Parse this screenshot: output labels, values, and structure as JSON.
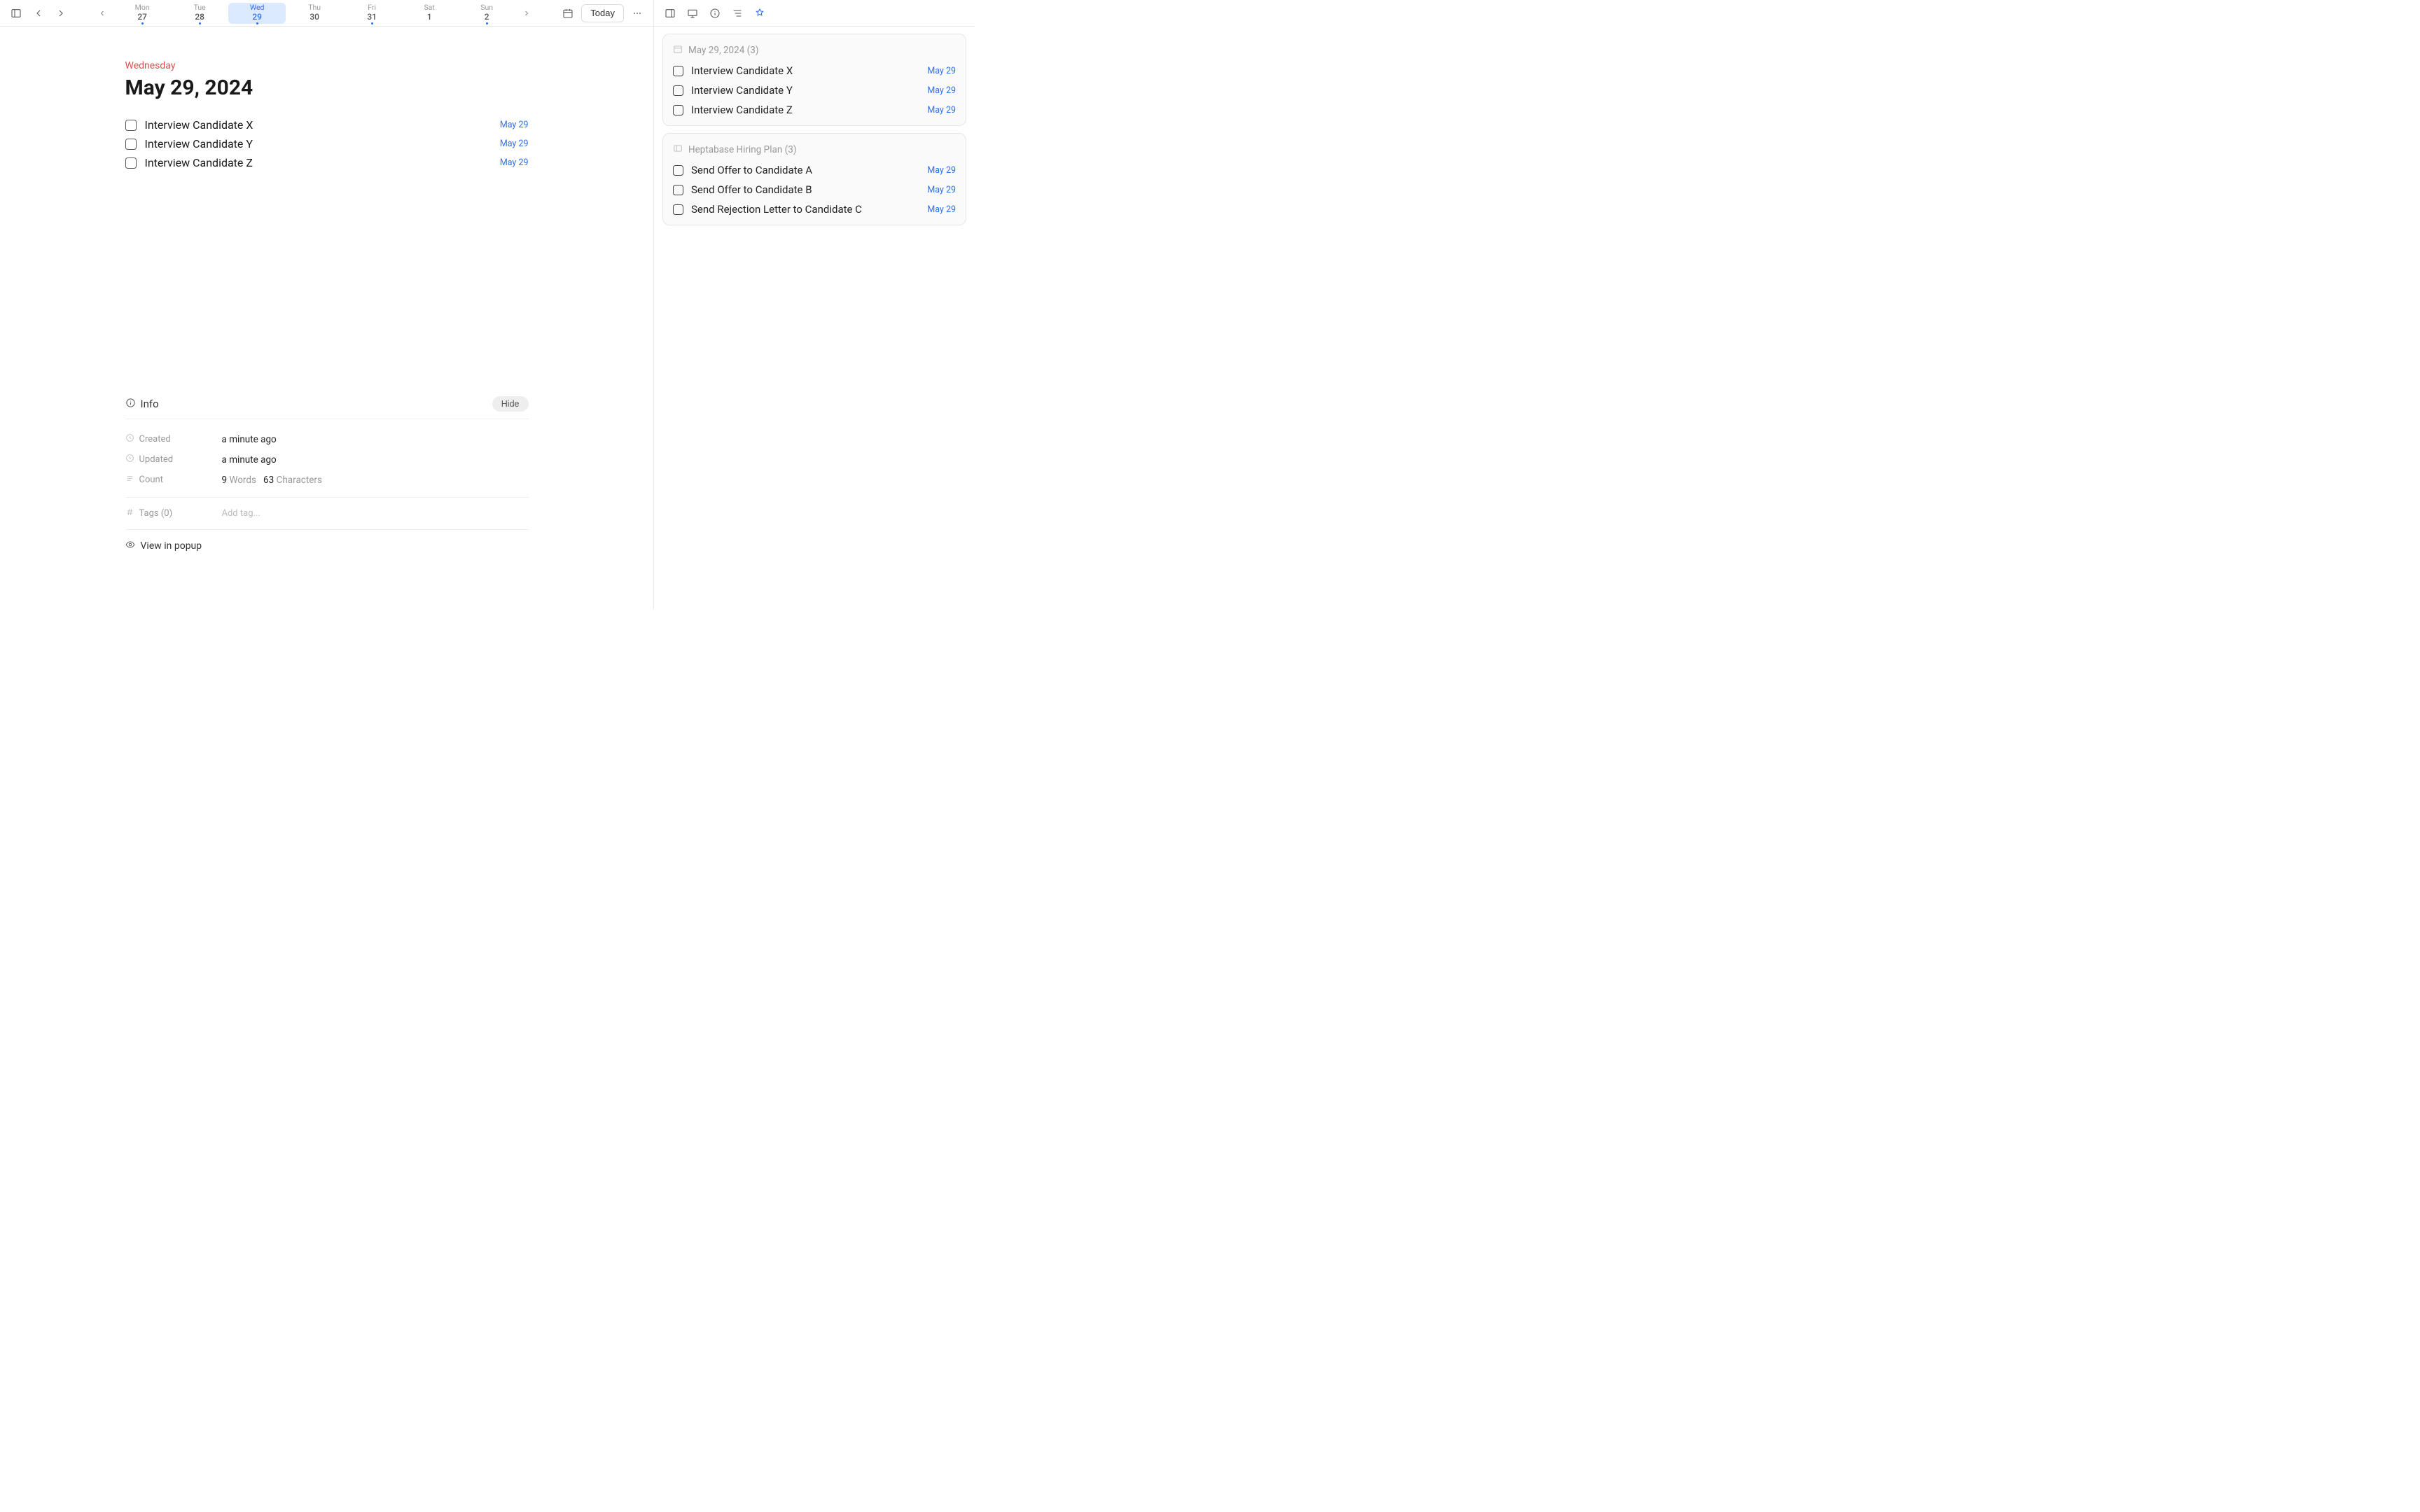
{
  "topbar": {
    "today_label": "Today",
    "days": [
      {
        "dow": "Mon",
        "num": "27",
        "selected": false,
        "dot": true
      },
      {
        "dow": "Tue",
        "num": "28",
        "selected": false,
        "dot": true
      },
      {
        "dow": "Wed",
        "num": "29",
        "selected": true,
        "dot": true
      },
      {
        "dow": "Thu",
        "num": "30",
        "selected": false,
        "dot": false
      },
      {
        "dow": "Fri",
        "num": "31",
        "selected": false,
        "dot": true
      },
      {
        "dow": "Sat",
        "num": "1",
        "selected": false,
        "dot": false
      },
      {
        "dow": "Sun",
        "num": "2",
        "selected": false,
        "dot": true
      }
    ]
  },
  "note": {
    "weekday": "Wednesday",
    "title": "May 29, 2024",
    "tasks": [
      {
        "text": "Interview Candidate X",
        "date": "May 29"
      },
      {
        "text": "Interview Candidate Y",
        "date": "May 29"
      },
      {
        "text": "Interview Candidate Z",
        "date": "May 29"
      }
    ]
  },
  "info": {
    "label": "Info",
    "hide_label": "Hide",
    "created_label": "Created",
    "created_value": "a minute ago",
    "updated_label": "Updated",
    "updated_value": "a minute ago",
    "count_label": "Count",
    "words_num": "9",
    "words_label": "Words",
    "chars_num": "63",
    "chars_label": "Characters",
    "tags_label": "Tags (0)",
    "add_tag_placeholder": "Add tag...",
    "popup_label": "View in popup"
  },
  "sidebar": {
    "groups": [
      {
        "icon": "calendar",
        "title": "May 29, 2024 (3)",
        "items": [
          {
            "text": "Interview Candidate X",
            "date": "May 29"
          },
          {
            "text": "Interview Candidate Y",
            "date": "May 29"
          },
          {
            "text": "Interview Candidate Z",
            "date": "May 29"
          }
        ]
      },
      {
        "icon": "board",
        "title": "Heptabase Hiring Plan (3)",
        "items": [
          {
            "text": "Send Offer to Candidate A",
            "date": "May 29"
          },
          {
            "text": "Send Offer to Candidate B",
            "date": "May 29"
          },
          {
            "text": "Send Rejection Letter to Candidate C",
            "date": "May 29"
          }
        ]
      }
    ]
  }
}
